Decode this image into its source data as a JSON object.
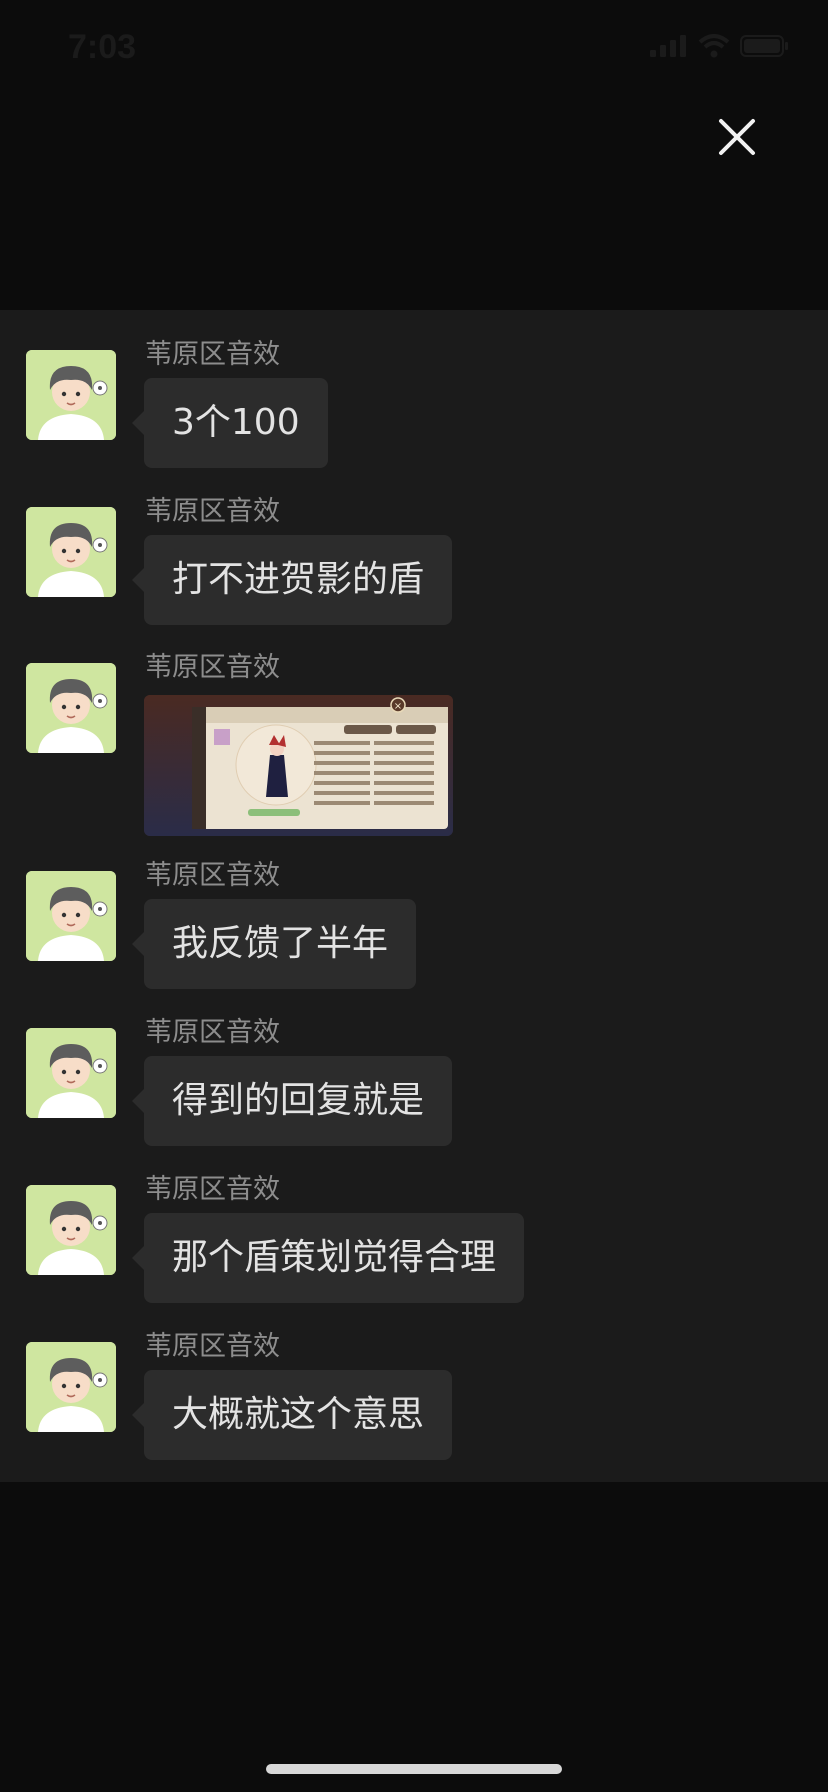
{
  "status": {
    "time": "7:03"
  },
  "messages": [
    {
      "sender": "苇原区音效",
      "text": "3个100"
    },
    {
      "sender": "苇原区音效",
      "text": "打不进贺影的盾"
    },
    {
      "sender": "苇原区音效",
      "type": "image"
    },
    {
      "sender": "苇原区音效",
      "text": "我反馈了半年"
    },
    {
      "sender": "苇原区音效",
      "text": "得到的回复就是"
    },
    {
      "sender": "苇原区音效",
      "text": "那个盾策划觉得合理"
    },
    {
      "sender": "苇原区音效",
      "text": "大概就这个意思"
    }
  ],
  "icons": {
    "close": "close-icon",
    "signal": "cellular-signal-icon",
    "wifi": "wifi-icon",
    "battery": "battery-icon",
    "avatar": "cartoon-boy-avatar"
  },
  "colors": {
    "background": "#0c0c0c",
    "panel": "#1b1b1b",
    "bubble": "#2c2c2c",
    "sender": "#8d8d8d",
    "text": "#e3e3e3"
  }
}
